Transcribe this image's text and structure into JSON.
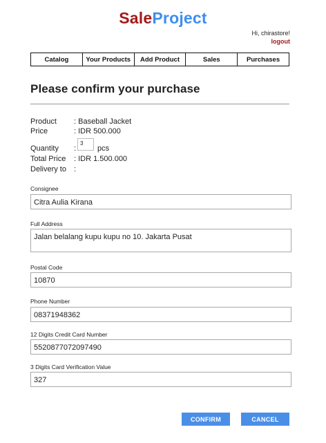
{
  "brand": {
    "part1": "Sale",
    "part2": "Project"
  },
  "user": {
    "greeting": "Hi, chirastore!",
    "logout": "logout"
  },
  "nav": [
    "Catalog",
    "Your Products",
    "Add Product",
    "Sales",
    "Purchases"
  ],
  "page_title": "Please confirm your purchase",
  "summary": {
    "product_label": "Product",
    "product_value": ": Baseball Jacket",
    "price_label": "Price",
    "price_value": ": IDR 500.000",
    "quantity_label": "Quantity",
    "quantity_colon": ":",
    "quantity_value": "3",
    "quantity_unit": "pcs",
    "total_label": "Total Price",
    "total_value": ": IDR 1.500.000",
    "delivery_label": "Delivery to",
    "delivery_value": ":"
  },
  "form": {
    "consignee_label": "Consignee",
    "consignee_value": "Citra Aulia Kirana",
    "address_label": "Full Address",
    "address_value": "Jalan belalang kupu kupu no 10. Jakarta Pusat",
    "postal_label": "Postal Code",
    "postal_value": "10870",
    "phone_label": "Phone Number",
    "phone_value": "08371948362",
    "card_label": "12 Digits Credit Card Number",
    "card_value": "5520877072097490",
    "cvv_label": "3 Digits Card Verification Value",
    "cvv_value": "327"
  },
  "buttons": {
    "confirm": "CONFIRM",
    "cancel": "CANCEL"
  }
}
